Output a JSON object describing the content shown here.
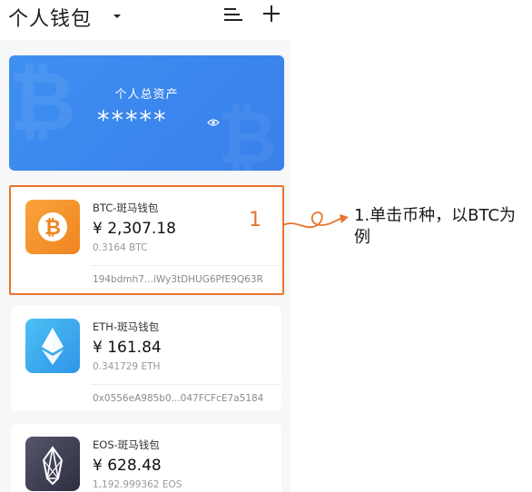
{
  "header": {
    "title": "个人钱包",
    "caret_icon": "chevron-down-icon",
    "menu_icon": "menu-icon",
    "add_icon": "plus-icon"
  },
  "asset_card": {
    "label": "个人总资产",
    "masked_value": "*****",
    "eye_icon": "eye-icon",
    "color": "#3a86ee"
  },
  "wallets": [
    {
      "name": "BTC-斑马钱包",
      "value": "¥ 2,307.18",
      "amount": "0.3164 BTC",
      "address": "194bdmh7...iWy3tDHUG6PfE9Q63R",
      "icon": "bitcoin-icon",
      "color": "#f7931a"
    },
    {
      "name": "ETH-斑马钱包",
      "value": "¥ 161.84",
      "amount": "0.341729 ETH",
      "address": "0x0556eA985b0...047FCFcE7a5184",
      "icon": "ethereum-icon",
      "color": "#3fa8ee"
    },
    {
      "name": "EOS-斑马钱包",
      "value": "¥ 628.48",
      "amount": "1,192.999362 EOS",
      "icon": "eos-icon",
      "color": "#3b3b4f"
    }
  ],
  "annotation": {
    "step_number": "1",
    "text": "1.单击币种，以BTC为例",
    "color": "#e9742f"
  }
}
